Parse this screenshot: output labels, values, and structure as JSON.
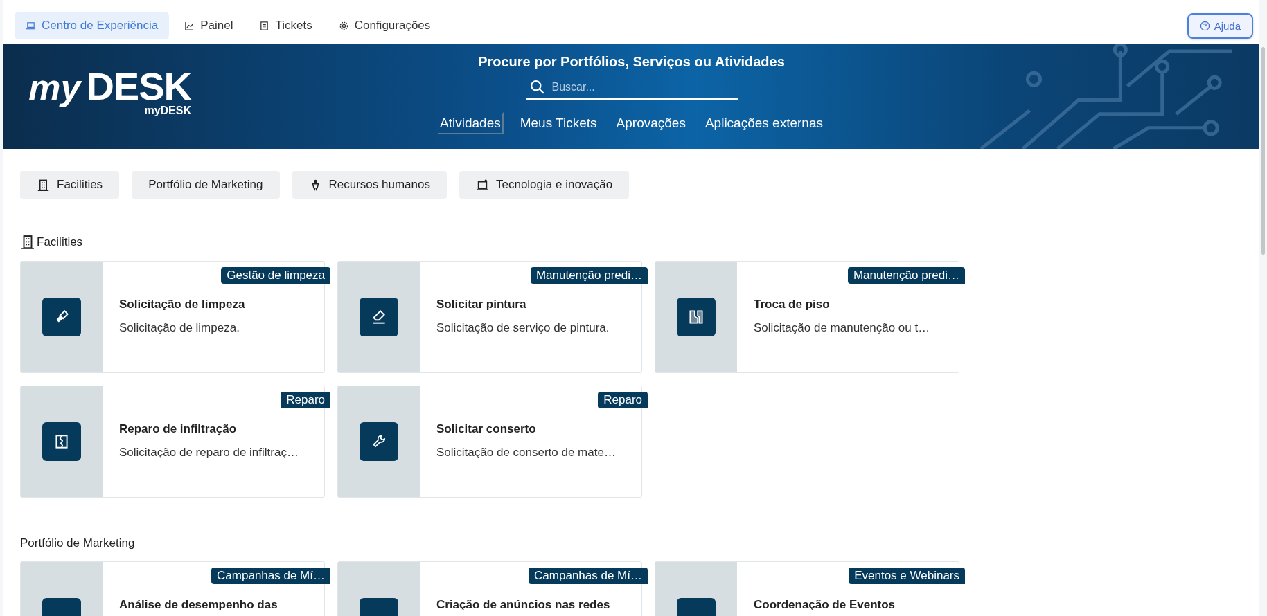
{
  "top_nav": {
    "tabs": [
      {
        "label": "Centro de Experiência",
        "kind": "laptop",
        "selected": true
      },
      {
        "label": "Painel",
        "kind": "chart",
        "selected": false
      },
      {
        "label": "Tickets",
        "kind": "list",
        "selected": false
      },
      {
        "label": "Configurações",
        "kind": "gear",
        "selected": false
      }
    ],
    "help_button": "Ajuda"
  },
  "banner": {
    "logo": {
      "my": "my",
      "desk": "DESK",
      "caption": "myDESK"
    },
    "heading": "Procure por Portfólios, Serviços ou Atividades",
    "search": {
      "placeholder": "Buscar..."
    },
    "tabs": [
      {
        "label": "Atividades",
        "selected": true
      },
      {
        "label": "Meus Tickets",
        "selected": false
      },
      {
        "label": "Aprovações",
        "selected": false
      },
      {
        "label": "Aplicações externas",
        "selected": false
      }
    ]
  },
  "filters": [
    {
      "label": "Facilities",
      "kind": "building"
    },
    {
      "label": "Portfólio de Marketing",
      "kind": "none"
    },
    {
      "label": "Recursos humanos",
      "kind": "person"
    },
    {
      "label": "Tecnologia e inovação",
      "kind": "laptop"
    }
  ],
  "sections": [
    {
      "title": "Facilities",
      "kind": "building",
      "cards": [
        {
          "tag": "Gestão de limpeza",
          "title": "Solicitação de limpeza",
          "description": "Solicitação de limpeza.",
          "kind": "brush"
        },
        {
          "tag": "Manutenção predi…",
          "title": "Solicitar pintura",
          "description": "Solicitação de serviço de pintura.",
          "kind": "eraser"
        },
        {
          "tag": "Manutenção predi…",
          "title": "Troca de piso",
          "description": "Solicitação de manutenção ou t…",
          "kind": "floor"
        },
        {
          "tag": "Reparo",
          "title": "Reparo de infiltração",
          "description": "Solicitação de reparo de infiltraç…",
          "kind": "leak"
        },
        {
          "tag": "Reparo",
          "title": "Solicitar conserto",
          "description": "Solicitação de conserto de mate…",
          "kind": "wrench"
        }
      ]
    },
    {
      "title": "Portfólio de Marketing",
      "kind": "none",
      "cards": [
        {
          "tag": "Campanhas de Mí…",
          "title": "Análise de desempenho das"
        },
        {
          "tag": "Campanhas de Mí…",
          "title": "Criação de anúncios nas redes"
        },
        {
          "tag": "Eventos e Webinars",
          "title": "Coordenação de Eventos"
        }
      ]
    }
  ]
}
